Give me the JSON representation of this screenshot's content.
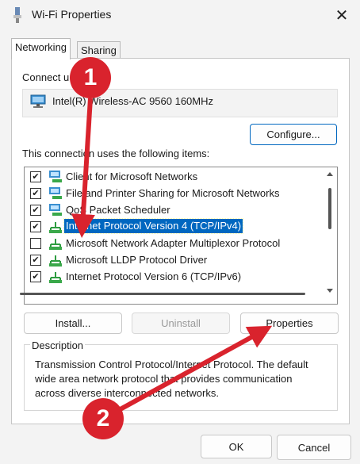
{
  "window": {
    "title": "Wi-Fi Properties",
    "close_glyph": "✕"
  },
  "tabs": [
    {
      "label": "Networking"
    },
    {
      "label": "Sharing"
    }
  ],
  "connect_using": {
    "label": "Connect u",
    "adapter": "Intel(R) Wireless-AC 9560 160MHz"
  },
  "buttons": {
    "configure": "Configure...",
    "install": "Install...",
    "uninstall": "Uninstall",
    "properties": "Properties",
    "ok": "OK",
    "cancel": "Cancel"
  },
  "items_label": "This connection uses the following items:",
  "items": [
    {
      "label": "Client for Microsoft Networks",
      "checked": true,
      "icon": "client-network-icon"
    },
    {
      "label": "File and Printer Sharing for Microsoft Networks",
      "checked": true,
      "icon": "file-sharing-icon"
    },
    {
      "label": "QoS Packet Scheduler",
      "checked": true,
      "icon": "qos-icon"
    },
    {
      "label": "Internet Protocol Version 4 (TCP/IPv4)",
      "checked": true,
      "icon": "protocol-icon",
      "selected": true
    },
    {
      "label": "Microsoft Network Adapter Multiplexor Protocol",
      "checked": false,
      "icon": "protocol-icon"
    },
    {
      "label": "Microsoft LLDP Protocol Driver",
      "checked": true,
      "icon": "protocol-icon"
    },
    {
      "label": "Internet Protocol Version 6 (TCP/IPv6)",
      "checked": true,
      "icon": "protocol-icon"
    }
  ],
  "description": {
    "title": "Description",
    "text": "Transmission Control Protocol/Internet Protocol. The default wide area network protocol that provides communication across diverse interconnected networks."
  },
  "annotations": [
    {
      "number": "1"
    },
    {
      "number": "2"
    }
  ],
  "colors": {
    "accent": "#0067c0",
    "annotation": "#d9232d"
  }
}
